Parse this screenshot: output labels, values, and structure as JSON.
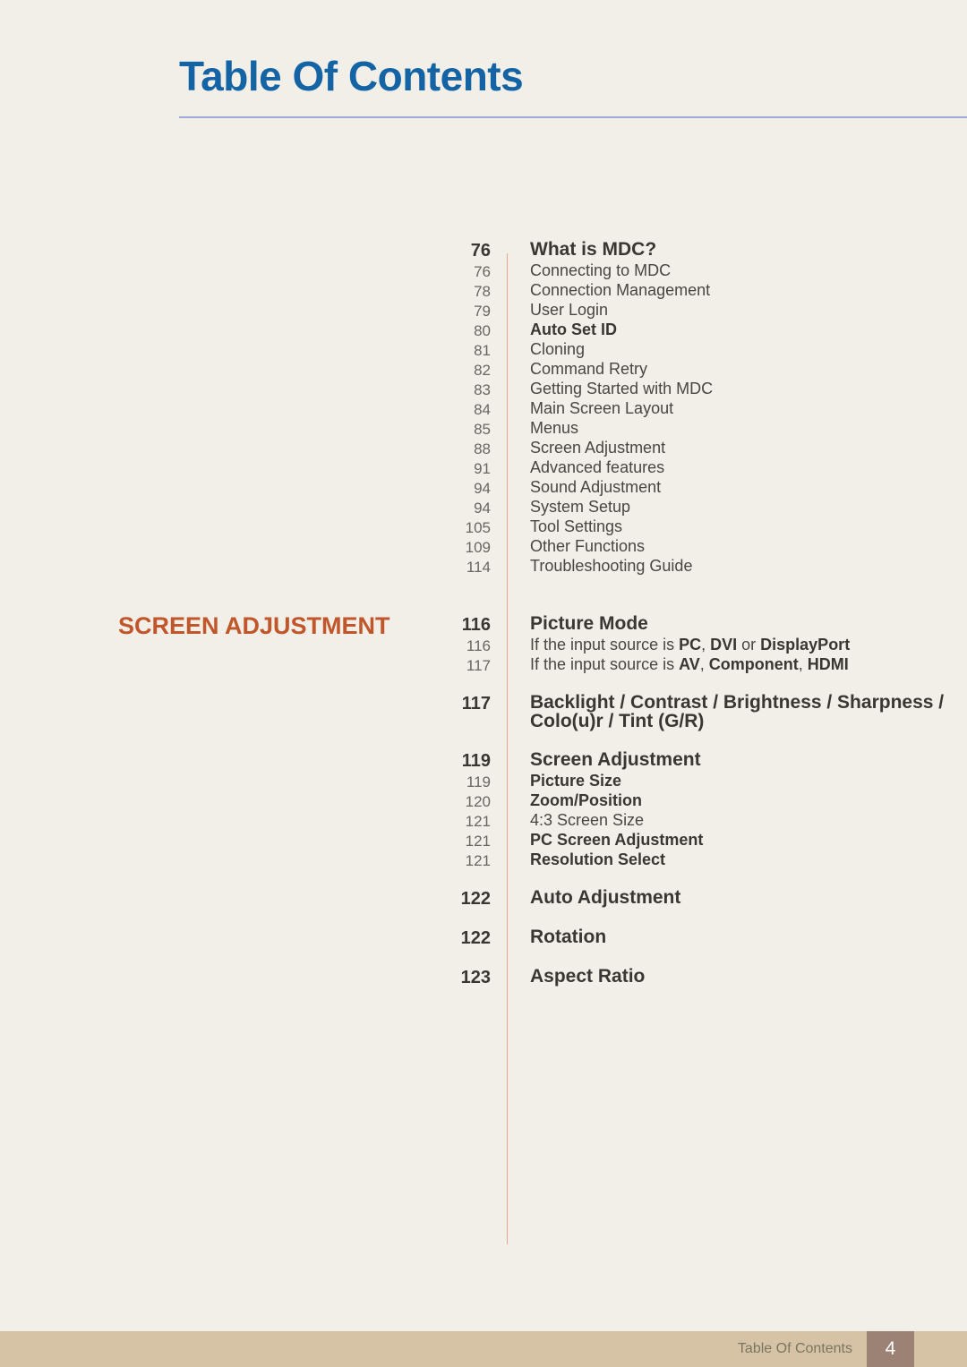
{
  "header": {
    "title": "Table Of Contents",
    "rule_color": "#9aa8da",
    "title_color": "#1464a5"
  },
  "page": {
    "background_color": "#f2efe8",
    "divider_color": "#e8a48c",
    "section_label_color": "#c1562a"
  },
  "toc": {
    "groups": [
      {
        "section_label": "",
        "rows": [
          {
            "level": 1,
            "num": "76",
            "label": "What is MDC?"
          },
          {
            "level": 2,
            "num": "76",
            "label": "Connecting to MDC"
          },
          {
            "level": 2,
            "num": "78",
            "label": "Connection Management"
          },
          {
            "level": 2,
            "num": "79",
            "label": "User Login"
          },
          {
            "level": 2,
            "num": "80",
            "label": "Auto Set ID",
            "bold": true
          },
          {
            "level": 2,
            "num": "81",
            "label": "Cloning"
          },
          {
            "level": 2,
            "num": "82",
            "label": "Command Retry"
          },
          {
            "level": 2,
            "num": "83",
            "label": "Getting Started with MDC"
          },
          {
            "level": 2,
            "num": "84",
            "label": "Main Screen Layout"
          },
          {
            "level": 2,
            "num": "85",
            "label": "Menus"
          },
          {
            "level": 2,
            "num": "88",
            "label": "Screen Adjustment"
          },
          {
            "level": 2,
            "num": "91",
            "label": "Advanced features"
          },
          {
            "level": 2,
            "num": "94",
            "label": "Sound Adjustment"
          },
          {
            "level": 2,
            "num": "94",
            "label": "System Setup"
          },
          {
            "level": 2,
            "num": "105",
            "label": "Tool Settings"
          },
          {
            "level": 2,
            "num": "109",
            "label": "Other Functions"
          },
          {
            "level": 2,
            "num": "114",
            "label": "Troubleshooting Guide"
          }
        ]
      },
      {
        "section_label": "SCREEN ADJUSTMENT",
        "rows": [
          {
            "level": 1,
            "num": "116",
            "label": "Picture Mode"
          },
          {
            "level": 2,
            "num": "116",
            "label": "If the input source is PC, DVI or DisplayPort",
            "rich": [
              {
                "t": "If the input source is ",
                "b": false
              },
              {
                "t": "PC",
                "b": true
              },
              {
                "t": ", ",
                "b": false
              },
              {
                "t": "DVI",
                "b": true
              },
              {
                "t": " or ",
                "b": false
              },
              {
                "t": "DisplayPort",
                "b": true
              }
            ]
          },
          {
            "level": 2,
            "num": "117",
            "label": "If the input source is AV, Component, HDMI",
            "rich": [
              {
                "t": "If the input source is ",
                "b": false
              },
              {
                "t": "AV",
                "b": true
              },
              {
                "t": ", ",
                "b": false
              },
              {
                "t": "Component",
                "b": true
              },
              {
                "t": ", ",
                "b": false
              },
              {
                "t": "HDMI",
                "b": true
              }
            ]
          },
          {
            "level": 1,
            "num": "117",
            "label": "Backlight / Contrast / Brightness / Sharpness / Colo(u)r / Tint (G/R)",
            "gap": "md"
          },
          {
            "level": 1,
            "num": "119",
            "label": "Screen Adjustment",
            "gap": "md"
          },
          {
            "level": 2,
            "num": "119",
            "label": "Picture Size",
            "bold": true
          },
          {
            "level": 2,
            "num": "120",
            "label": "Zoom/Position",
            "bold": true
          },
          {
            "level": 2,
            "num": "121",
            "label": "4:3 Screen Size"
          },
          {
            "level": 2,
            "num": "121",
            "label": "PC Screen Adjustment",
            "bold": true
          },
          {
            "level": 2,
            "num": "121",
            "label": "Resolution Select",
            "bold": true
          },
          {
            "level": 1,
            "num": "122",
            "label": "Auto Adjustment",
            "gap": "md"
          },
          {
            "level": 1,
            "num": "122",
            "label": "Rotation",
            "gap": "md"
          },
          {
            "level": 1,
            "num": "123",
            "label": "Aspect Ratio",
            "gap": "md"
          }
        ]
      }
    ]
  },
  "footer": {
    "label": "Table Of Contents",
    "page_number": "4",
    "bar_color": "#d6c3a6",
    "page_box_color": "#9c8274"
  }
}
